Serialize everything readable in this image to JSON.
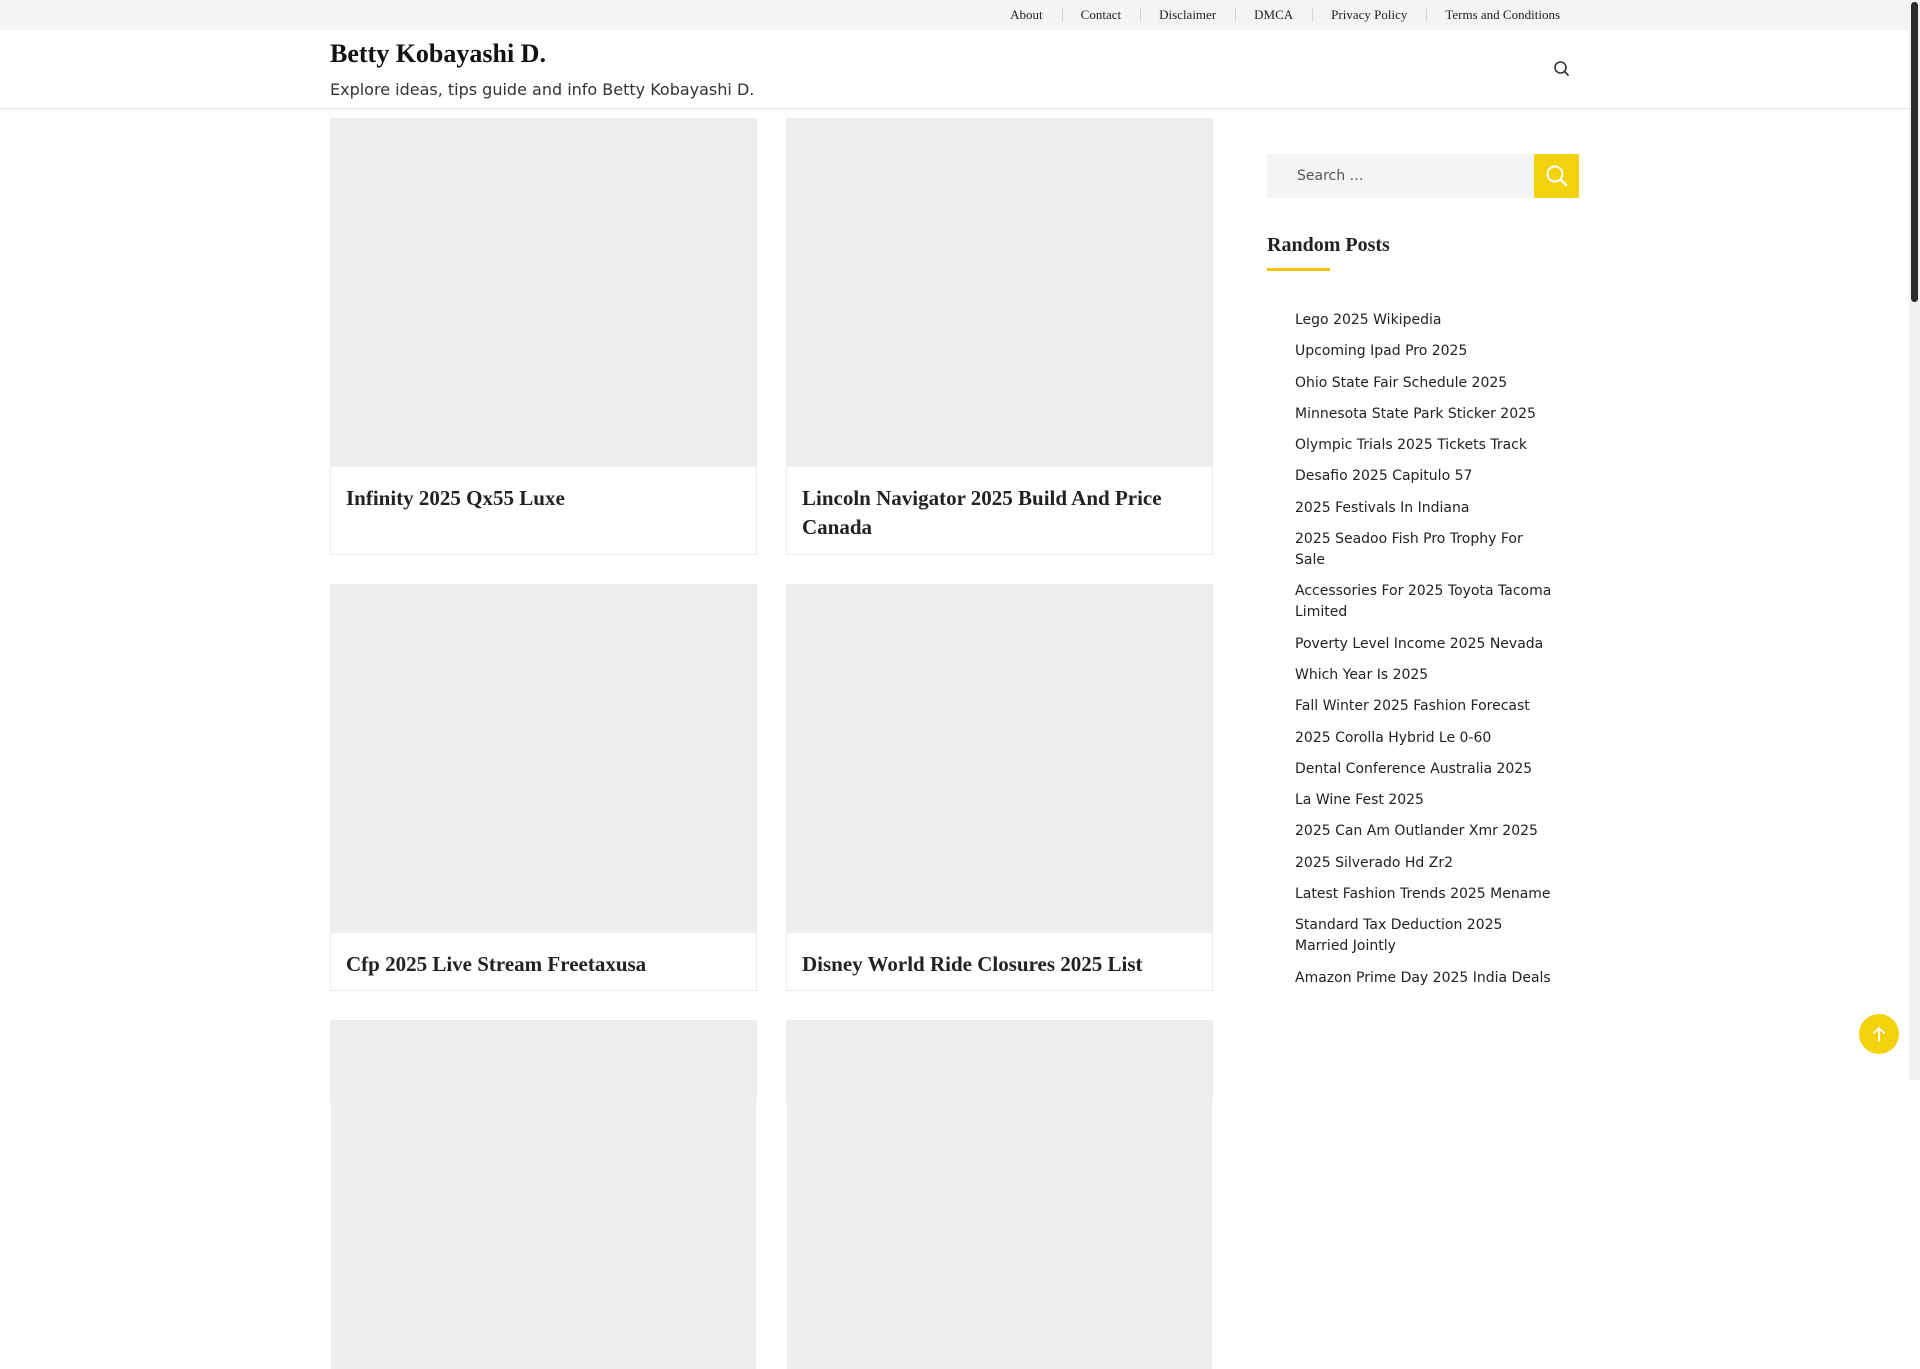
{
  "topnav": [
    {
      "label": "About"
    },
    {
      "label": "Contact"
    },
    {
      "label": "Disclaimer"
    },
    {
      "label": "DMCA"
    },
    {
      "label": "Privacy Policy"
    },
    {
      "label": "Terms and Conditions"
    }
  ],
  "header": {
    "title": "Betty Kobayashi D.",
    "description": "Explore ideas, tips guide and info Betty Kobayashi D.",
    "search_icon": "search-icon"
  },
  "posts": [
    {
      "title": "Infinity 2025 Qx55 Luxe"
    },
    {
      "title": "Lincoln Navigator 2025 Build And Price Canada"
    },
    {
      "title": "Cfp 2025 Live Stream Freetaxusa"
    },
    {
      "title": "Disney World Ride Closures 2025 List"
    },
    {
      "title": ""
    },
    {
      "title": ""
    }
  ],
  "sidebar": {
    "search_placeholder": "Search …",
    "search_button_icon": "search-icon",
    "widget_title": "Random Posts",
    "random_posts": [
      "Lego 2025 Wikipedia",
      "Upcoming Ipad Pro 2025",
      "Ohio State Fair Schedule 2025",
      "Minnesota State Park Sticker 2025",
      "Olympic Trials 2025 Tickets Track",
      "Desafio 2025 Capitulo 57",
      "2025 Festivals In Indiana",
      "2025 Seadoo Fish Pro Trophy For Sale",
      "Accessories For 2025 Toyota Tacoma Limited",
      "Poverty Level Income 2025 Nevada",
      "Which Year Is 2025",
      "Fall Winter 2025 Fashion Forecast",
      "2025 Corolla Hybrid Le 0-60",
      "Dental Conference Australia 2025",
      "La Wine Fest 2025",
      "2025 Can Am Outlander Xmr 2025",
      "2025 Silverado Hd Zr2",
      "Latest Fashion Trends 2025 Mename",
      "Standard Tax Deduction 2025 Married Jointly",
      "Amazon Prime Day 2025 India Deals"
    ]
  },
  "back_to_top_icon": "arrow-up-icon",
  "colors": {
    "accent": "#f2d20d",
    "underline": "#f2c500",
    "placeholder_bg": "#eeeeee",
    "topbar_bg": "#f4f4f4"
  }
}
